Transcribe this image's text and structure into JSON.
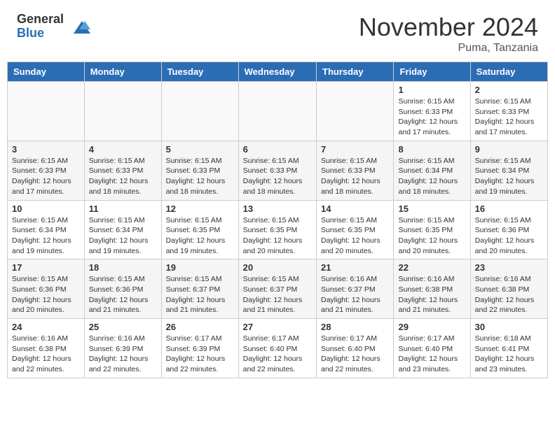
{
  "header": {
    "logo_general": "General",
    "logo_blue": "Blue",
    "month_title": "November 2024",
    "location": "Puma, Tanzania"
  },
  "weekdays": [
    "Sunday",
    "Monday",
    "Tuesday",
    "Wednesday",
    "Thursday",
    "Friday",
    "Saturday"
  ],
  "weeks": [
    [
      {
        "day": "",
        "info": ""
      },
      {
        "day": "",
        "info": ""
      },
      {
        "day": "",
        "info": ""
      },
      {
        "day": "",
        "info": ""
      },
      {
        "day": "",
        "info": ""
      },
      {
        "day": "1",
        "info": "Sunrise: 6:15 AM\nSunset: 6:33 PM\nDaylight: 12 hours and 17 minutes."
      },
      {
        "day": "2",
        "info": "Sunrise: 6:15 AM\nSunset: 6:33 PM\nDaylight: 12 hours and 17 minutes."
      }
    ],
    [
      {
        "day": "3",
        "info": "Sunrise: 6:15 AM\nSunset: 6:33 PM\nDaylight: 12 hours and 17 minutes."
      },
      {
        "day": "4",
        "info": "Sunrise: 6:15 AM\nSunset: 6:33 PM\nDaylight: 12 hours and 18 minutes."
      },
      {
        "day": "5",
        "info": "Sunrise: 6:15 AM\nSunset: 6:33 PM\nDaylight: 12 hours and 18 minutes."
      },
      {
        "day": "6",
        "info": "Sunrise: 6:15 AM\nSunset: 6:33 PM\nDaylight: 12 hours and 18 minutes."
      },
      {
        "day": "7",
        "info": "Sunrise: 6:15 AM\nSunset: 6:33 PM\nDaylight: 12 hours and 18 minutes."
      },
      {
        "day": "8",
        "info": "Sunrise: 6:15 AM\nSunset: 6:34 PM\nDaylight: 12 hours and 18 minutes."
      },
      {
        "day": "9",
        "info": "Sunrise: 6:15 AM\nSunset: 6:34 PM\nDaylight: 12 hours and 19 minutes."
      }
    ],
    [
      {
        "day": "10",
        "info": "Sunrise: 6:15 AM\nSunset: 6:34 PM\nDaylight: 12 hours and 19 minutes."
      },
      {
        "day": "11",
        "info": "Sunrise: 6:15 AM\nSunset: 6:34 PM\nDaylight: 12 hours and 19 minutes."
      },
      {
        "day": "12",
        "info": "Sunrise: 6:15 AM\nSunset: 6:35 PM\nDaylight: 12 hours and 19 minutes."
      },
      {
        "day": "13",
        "info": "Sunrise: 6:15 AM\nSunset: 6:35 PM\nDaylight: 12 hours and 20 minutes."
      },
      {
        "day": "14",
        "info": "Sunrise: 6:15 AM\nSunset: 6:35 PM\nDaylight: 12 hours and 20 minutes."
      },
      {
        "day": "15",
        "info": "Sunrise: 6:15 AM\nSunset: 6:35 PM\nDaylight: 12 hours and 20 minutes."
      },
      {
        "day": "16",
        "info": "Sunrise: 6:15 AM\nSunset: 6:36 PM\nDaylight: 12 hours and 20 minutes."
      }
    ],
    [
      {
        "day": "17",
        "info": "Sunrise: 6:15 AM\nSunset: 6:36 PM\nDaylight: 12 hours and 20 minutes."
      },
      {
        "day": "18",
        "info": "Sunrise: 6:15 AM\nSunset: 6:36 PM\nDaylight: 12 hours and 21 minutes."
      },
      {
        "day": "19",
        "info": "Sunrise: 6:15 AM\nSunset: 6:37 PM\nDaylight: 12 hours and 21 minutes."
      },
      {
        "day": "20",
        "info": "Sunrise: 6:15 AM\nSunset: 6:37 PM\nDaylight: 12 hours and 21 minutes."
      },
      {
        "day": "21",
        "info": "Sunrise: 6:16 AM\nSunset: 6:37 PM\nDaylight: 12 hours and 21 minutes."
      },
      {
        "day": "22",
        "info": "Sunrise: 6:16 AM\nSunset: 6:38 PM\nDaylight: 12 hours and 21 minutes."
      },
      {
        "day": "23",
        "info": "Sunrise: 6:16 AM\nSunset: 6:38 PM\nDaylight: 12 hours and 22 minutes."
      }
    ],
    [
      {
        "day": "24",
        "info": "Sunrise: 6:16 AM\nSunset: 6:38 PM\nDaylight: 12 hours and 22 minutes."
      },
      {
        "day": "25",
        "info": "Sunrise: 6:16 AM\nSunset: 6:39 PM\nDaylight: 12 hours and 22 minutes."
      },
      {
        "day": "26",
        "info": "Sunrise: 6:17 AM\nSunset: 6:39 PM\nDaylight: 12 hours and 22 minutes."
      },
      {
        "day": "27",
        "info": "Sunrise: 6:17 AM\nSunset: 6:40 PM\nDaylight: 12 hours and 22 minutes."
      },
      {
        "day": "28",
        "info": "Sunrise: 6:17 AM\nSunset: 6:40 PM\nDaylight: 12 hours and 22 minutes."
      },
      {
        "day": "29",
        "info": "Sunrise: 6:17 AM\nSunset: 6:40 PM\nDaylight: 12 hours and 23 minutes."
      },
      {
        "day": "30",
        "info": "Sunrise: 6:18 AM\nSunset: 6:41 PM\nDaylight: 12 hours and 23 minutes."
      }
    ]
  ]
}
